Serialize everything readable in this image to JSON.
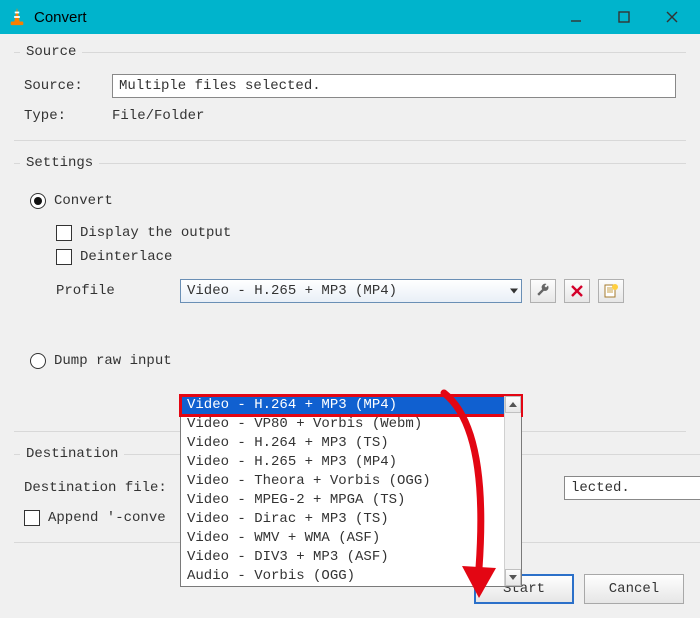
{
  "window": {
    "title": "Convert"
  },
  "source": {
    "legend": "Source",
    "source_label": "Source:",
    "source_value": "Multiple files selected.",
    "type_label": "Type:",
    "type_value": "File/Folder"
  },
  "settings": {
    "legend": "Settings",
    "convert_label": "Convert",
    "display_output_label": "Display the output",
    "deinterlace_label": "Deinterlace",
    "profile_label": "Profile",
    "profile_selected": "Video - H.265 + MP3 (MP4)",
    "dump_raw_label": "Dump raw input",
    "dropdown_items": [
      "Video - H.264 + MP3 (MP4)",
      "Video - VP80 + Vorbis (Webm)",
      "Video - H.264 + MP3 (TS)",
      "Video - H.265 + MP3 (MP4)",
      "Video - Theora + Vorbis (OGG)",
      "Video - MPEG-2 + MPGA (TS)",
      "Video - Dirac + MP3 (TS)",
      "Video - WMV + WMA (ASF)",
      "Video - DIV3 + MP3 (ASF)",
      "Audio - Vorbis (OGG)"
    ]
  },
  "destination": {
    "legend": "Destination",
    "file_label": "Destination file:",
    "file_value_suffix": "lected.",
    "append_label": "Append '-conve"
  },
  "buttons": {
    "start": "Start",
    "cancel": "Cancel"
  },
  "icons": {
    "wrench": "wrench-icon",
    "delete": "delete-icon",
    "new_profile": "new-profile-icon"
  }
}
